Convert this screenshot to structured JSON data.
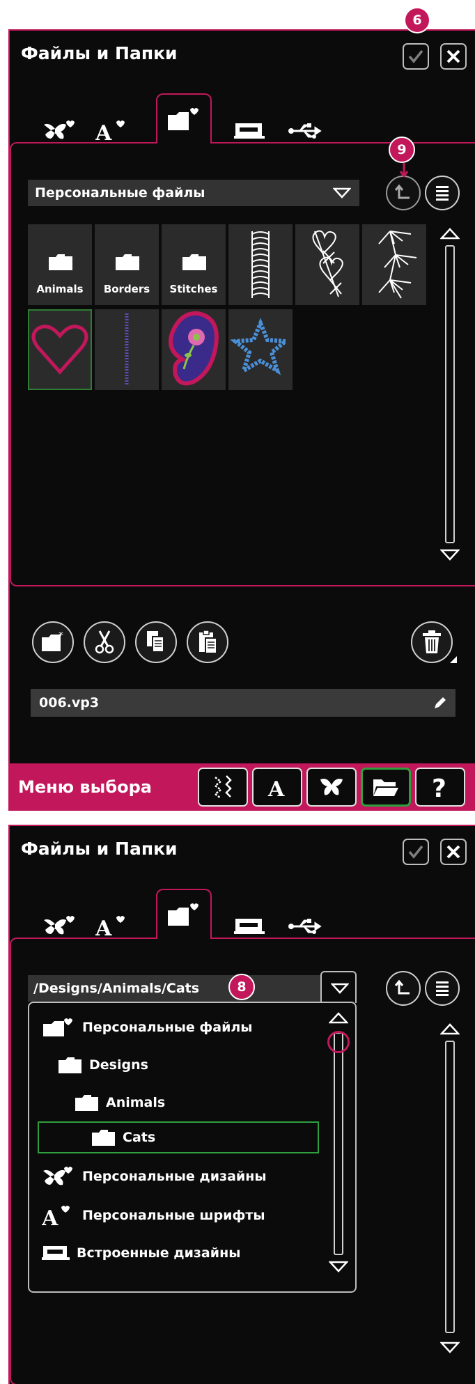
{
  "panel1": {
    "title": "Файлы и Папки",
    "location_dropdown": "Персональные файлы",
    "folders": [
      {
        "label": "Animals"
      },
      {
        "label": "Borders"
      },
      {
        "label": "Stitches"
      }
    ],
    "file_thumbnails": [
      "border-stitch-design",
      "hearts-stitch-design",
      "floral-stitch-design",
      "heart-design",
      "line-stitch-design",
      "paisley-design",
      "star-design"
    ],
    "filename": "006.vp3",
    "markers": {
      "confirm": "6",
      "up_level": "9"
    },
    "bottom_bar": {
      "label": "Меню выбора"
    }
  },
  "panel2": {
    "title": "Файлы и Папки",
    "path": "/Designs/Animals/Cats",
    "marker_path": "8",
    "tree": [
      {
        "label": "Персональные файлы",
        "icon": "folder-heart-icon",
        "level": 0
      },
      {
        "label": "Designs",
        "icon": "folder-icon",
        "level": 1
      },
      {
        "label": "Animals",
        "icon": "folder-icon",
        "level": 2
      },
      {
        "label": "Cats",
        "icon": "folder-icon",
        "level": 3,
        "selected": true
      },
      {
        "label": "Персональные дизайны",
        "icon": "butterfly-heart-icon",
        "level": 0
      },
      {
        "label": "Персональные шрифты",
        "icon": "font-heart-icon",
        "level": 0
      },
      {
        "label": "Встроенные дизайны",
        "icon": "machine-icon",
        "level": 0
      }
    ]
  },
  "colors": {
    "accent": "#c2185b",
    "selected": "#2e9e3e",
    "panel_bg": "#0b0b0b",
    "field_bg": "#333333"
  }
}
